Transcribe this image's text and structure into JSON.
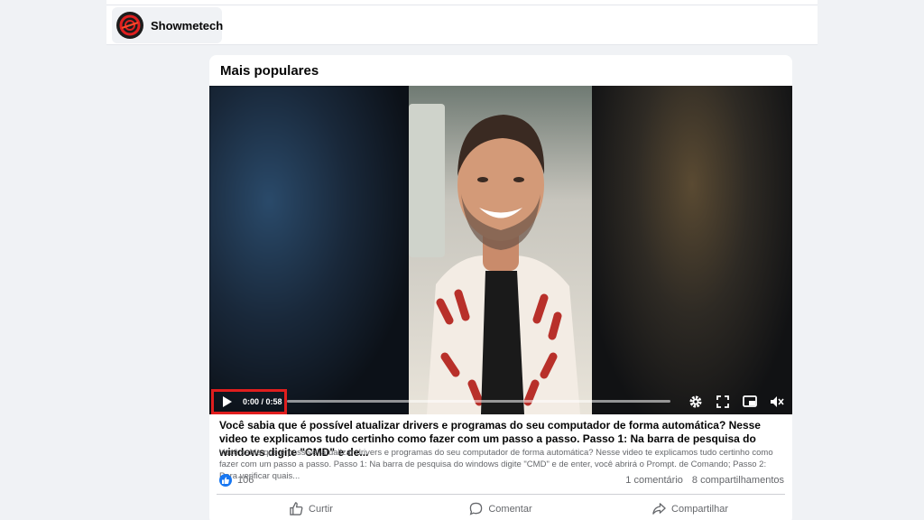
{
  "header": {
    "page_name": "Showmetech",
    "avatar_color": "#1c1c1c",
    "avatar_accent": "#e02020"
  },
  "card": {
    "title": "Mais populares"
  },
  "video": {
    "time": "0:00 / 0:58",
    "progress": 0,
    "highlight_color": "#e01e1e",
    "controls": [
      "play-icon",
      "gear-icon",
      "fullscreen-icon",
      "picture-in-picture-icon",
      "mute-icon"
    ]
  },
  "post": {
    "title": "Você sabia que é possível atualizar drivers e programas do seu computador de forma automática? Nesse video te explicamos tudo certinho como fazer com um passo a passo. Passo 1: Na barra de pesquisa do windows digite \"CMD\" e de...",
    "description": "Você sabia que é possível atualizar drivers e programas do seu computador de forma automática? Nesse video te explicamos tudo certinho como fazer com um passo a passo. Passo 1: Na barra de pesquisa do windows digite \"CMD\" e de enter, você abrirá o Prompt. de Comando; Passo 2: Para verificar quais..."
  },
  "stats": {
    "likes": "106",
    "comments": "1 comentário",
    "shares": "8 compartilhamentos",
    "like_color": "#1877f2"
  },
  "actions": {
    "like": "Curtir",
    "comment": "Comentar",
    "share": "Compartilhar"
  }
}
